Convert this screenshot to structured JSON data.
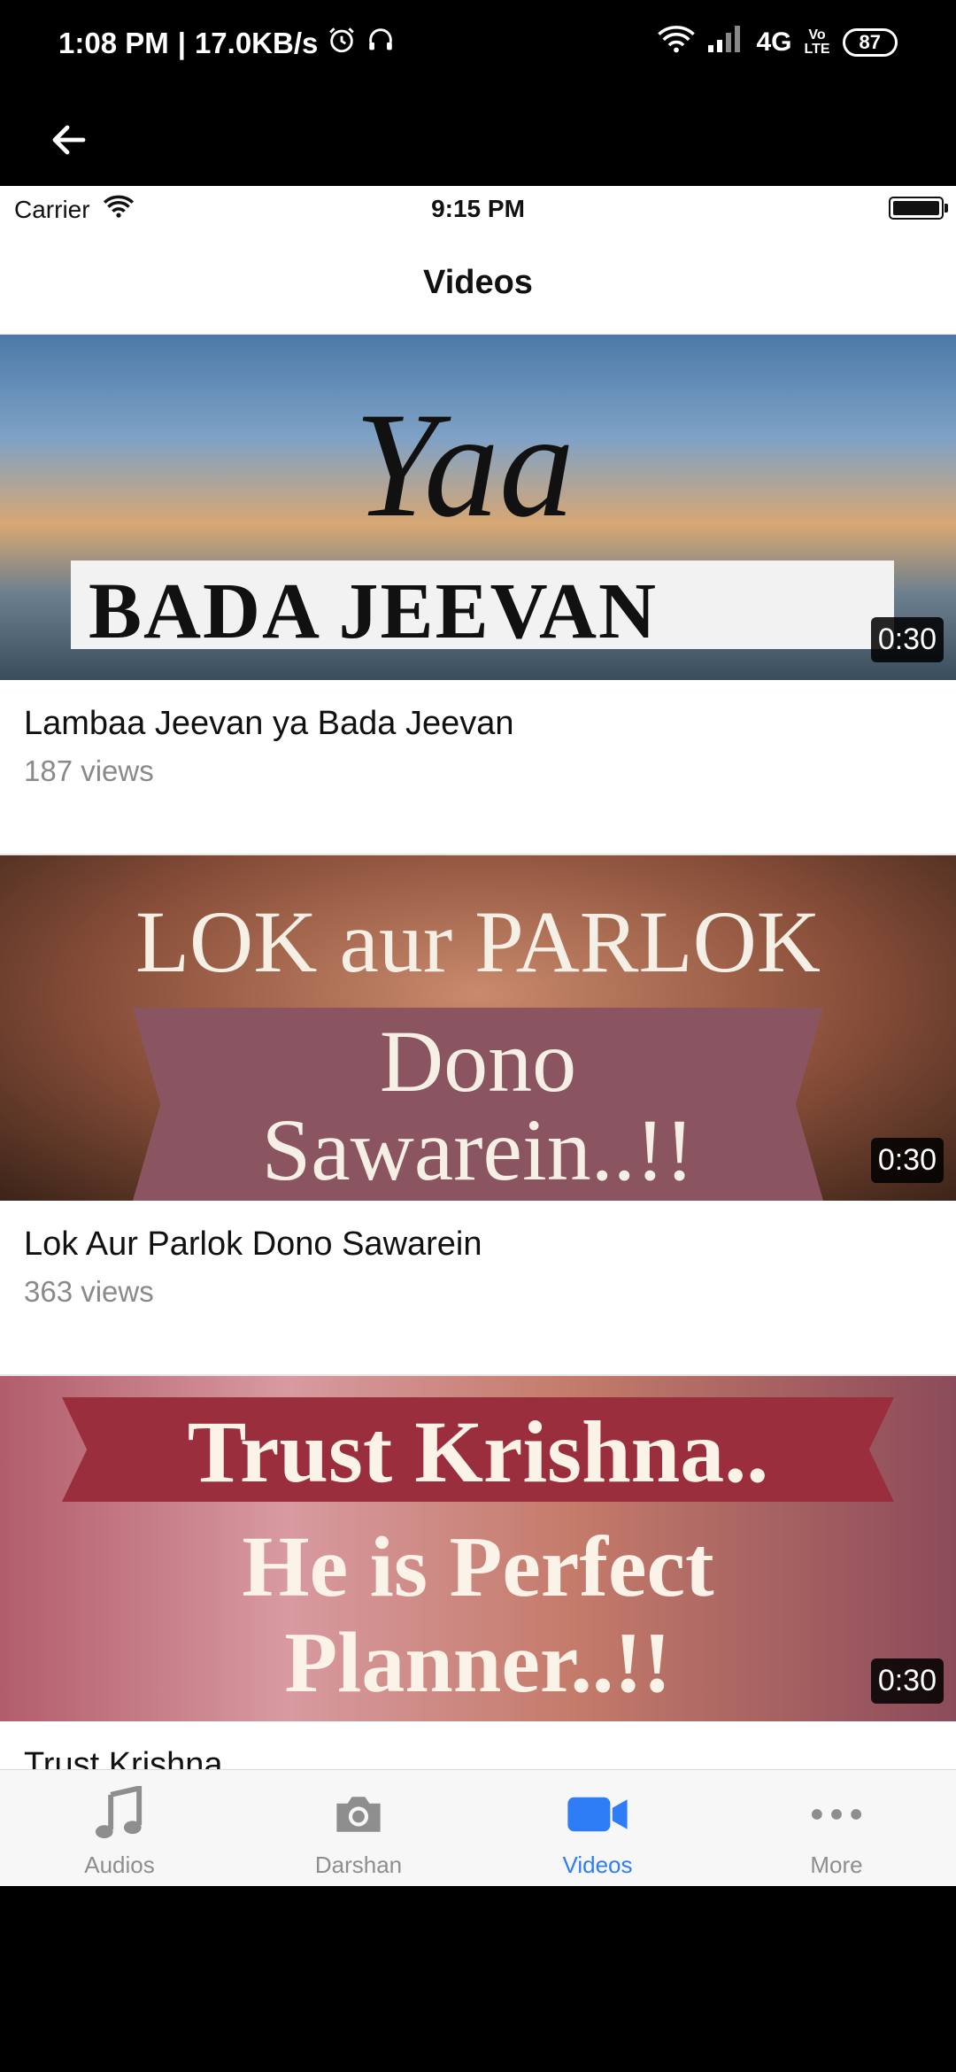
{
  "android_status": {
    "time": "1:08 PM",
    "separator": "|",
    "speed": "17.0KB/s",
    "network": "4G",
    "volte_top": "Vo",
    "volte_bottom": "LTE",
    "battery": "87"
  },
  "ios_status": {
    "carrier": "Carrier",
    "time": "9:15 PM"
  },
  "navbar": {
    "title": "Videos"
  },
  "videos": [
    {
      "thumb_line1": "Yaa",
      "thumb_line2": "BADA JEEVAN",
      "duration": "0:30",
      "title": "Lambaa Jeevan ya Bada Jeevan",
      "views": "187 views"
    },
    {
      "thumb_line1": "LOK aur PARLOK",
      "thumb_line2": "Dono",
      "thumb_line3": "Sawarein..!!",
      "duration": "0:30",
      "title": "Lok Aur Parlok Dono Sawarein",
      "views": "363 views"
    },
    {
      "thumb_line1": "Trust Krishna..",
      "thumb_line2": "He is Perfect",
      "thumb_line3": "Planner..!!",
      "duration": "0:30",
      "title": "Trust Krishna",
      "views": ""
    }
  ],
  "tabs": [
    {
      "label": "Audios",
      "icon": "music-note-icon",
      "active": false
    },
    {
      "label": "Darshan",
      "icon": "camera-icon",
      "active": false
    },
    {
      "label": "Videos",
      "icon": "video-camera-icon",
      "active": true
    },
    {
      "label": "More",
      "icon": "more-dots-icon",
      "active": false
    }
  ],
  "colors": {
    "accent": "#2f7df6",
    "inactive": "#8e8e8e"
  }
}
